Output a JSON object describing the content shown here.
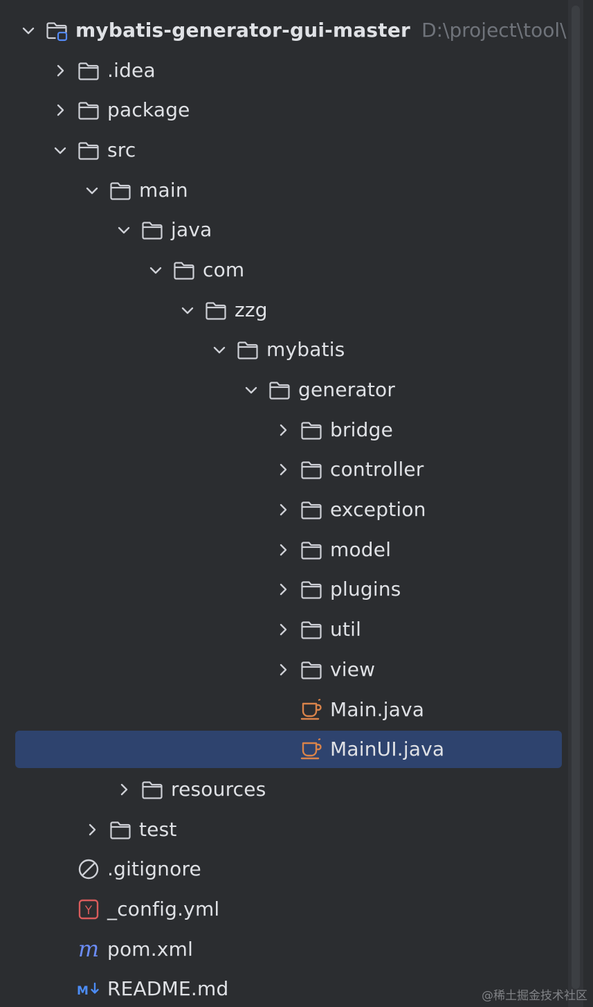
{
  "project": {
    "name": "mybatis-generator-gui-master",
    "path": "D:\\project\\tool\\"
  },
  "tree": [
    {
      "label": "mybatis-generator-gui-master",
      "depth": 0,
      "state": "expanded",
      "icon": "project-folder-icon",
      "root": true
    },
    {
      "label": ".idea",
      "depth": 1,
      "state": "collapsed",
      "icon": "folder-icon"
    },
    {
      "label": "package",
      "depth": 1,
      "state": "collapsed",
      "icon": "folder-icon"
    },
    {
      "label": "src",
      "depth": 1,
      "state": "expanded",
      "icon": "folder-icon"
    },
    {
      "label": "main",
      "depth": 2,
      "state": "expanded",
      "icon": "folder-icon"
    },
    {
      "label": "java",
      "depth": 3,
      "state": "expanded",
      "icon": "folder-icon"
    },
    {
      "label": "com",
      "depth": 4,
      "state": "expanded",
      "icon": "folder-icon"
    },
    {
      "label": "zzg",
      "depth": 5,
      "state": "expanded",
      "icon": "folder-icon"
    },
    {
      "label": "mybatis",
      "depth": 6,
      "state": "expanded",
      "icon": "folder-icon"
    },
    {
      "label": "generator",
      "depth": 7,
      "state": "expanded",
      "icon": "folder-icon"
    },
    {
      "label": "bridge",
      "depth": 8,
      "state": "collapsed",
      "icon": "folder-icon"
    },
    {
      "label": "controller",
      "depth": 8,
      "state": "collapsed",
      "icon": "folder-icon"
    },
    {
      "label": "exception",
      "depth": 8,
      "state": "collapsed",
      "icon": "folder-icon"
    },
    {
      "label": "model",
      "depth": 8,
      "state": "collapsed",
      "icon": "folder-icon"
    },
    {
      "label": "plugins",
      "depth": 8,
      "state": "collapsed",
      "icon": "folder-icon"
    },
    {
      "label": "util",
      "depth": 8,
      "state": "collapsed",
      "icon": "folder-icon"
    },
    {
      "label": "view",
      "depth": 8,
      "state": "collapsed",
      "icon": "folder-icon"
    },
    {
      "label": "Main.java",
      "depth": 8,
      "state": "leaf",
      "icon": "java-class-icon"
    },
    {
      "label": "MainUI.java",
      "depth": 8,
      "state": "leaf",
      "icon": "java-class-icon",
      "selected": true
    },
    {
      "label": "resources",
      "depth": 3,
      "state": "collapsed",
      "icon": "folder-icon"
    },
    {
      "label": "test",
      "depth": 2,
      "state": "collapsed",
      "icon": "folder-icon"
    },
    {
      "label": ".gitignore",
      "depth": 1,
      "state": "leaf",
      "icon": "ignore-file-icon"
    },
    {
      "label": "_config.yml",
      "depth": 1,
      "state": "leaf",
      "icon": "yaml-file-icon"
    },
    {
      "label": "pom.xml",
      "depth": 1,
      "state": "leaf",
      "icon": "maven-file-icon"
    },
    {
      "label": "README.md",
      "depth": 1,
      "state": "leaf",
      "icon": "markdown-file-icon"
    }
  ],
  "colors": {
    "background": "#2b2d30",
    "selection": "#2e436e",
    "text": "#dfe1e5",
    "muted": "#6f737a",
    "java_icon": "#d9834a",
    "yaml_icon": "#d95c5c",
    "maven_icon": "#6b8cf7",
    "markdown_icon": "#4c8cf5"
  },
  "watermark": "@稀土掘金技术社区"
}
